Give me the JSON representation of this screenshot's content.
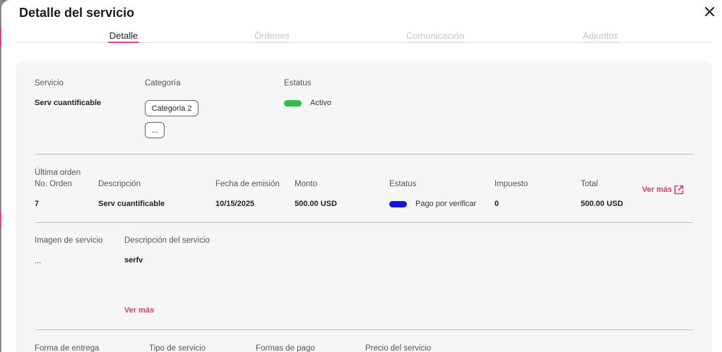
{
  "modal": {
    "title": "Detalle del servicio"
  },
  "tabs": [
    {
      "label": "Detalle",
      "active": true
    },
    {
      "label": "Órdenes",
      "active": false
    },
    {
      "label": "Comunicación",
      "active": false
    },
    {
      "label": "Adjuntos",
      "active": false
    }
  ],
  "summary": {
    "service_label": "Servicio",
    "service_value": "Serv cuantificable",
    "category_label": "Categoría",
    "category_chip": "Categoria 2",
    "category_more": "...",
    "status_label": "Estatus",
    "status_value": "Activo",
    "status_color": "#2fbf3a"
  },
  "last_order": {
    "section_label": "Última orden",
    "headers": {
      "number": "No. Orden",
      "description": "Descripción",
      "issue_date": "Fecha de emisión",
      "amount": "Monto",
      "status": "Estatus",
      "tax": "Impuesto",
      "total": "Total"
    },
    "row": {
      "number": "7",
      "description": "Serv cuantificable",
      "issue_date": "10/15/2025",
      "amount": "500.00 USD",
      "status": "Pago por verificar",
      "status_color": "#1414e6",
      "tax": "0",
      "total": "500.00 USD"
    },
    "see_more": "Ver más",
    "see_more_icon": "external-link-icon"
  },
  "details": {
    "image_label": "Imagen de servicio",
    "image_value": "...",
    "description_label": "Descripción del servicio",
    "description_value": "serfv",
    "see_more": "Ver más"
  },
  "footer_fields": {
    "delivery_label": "Forma de entrega",
    "type_label": "Tipo de servicio",
    "payment_label": "Formas de pago",
    "price_label": "Precio del servicio"
  },
  "colors": {
    "accent": "#e0457b",
    "link": "#d63c6e"
  }
}
